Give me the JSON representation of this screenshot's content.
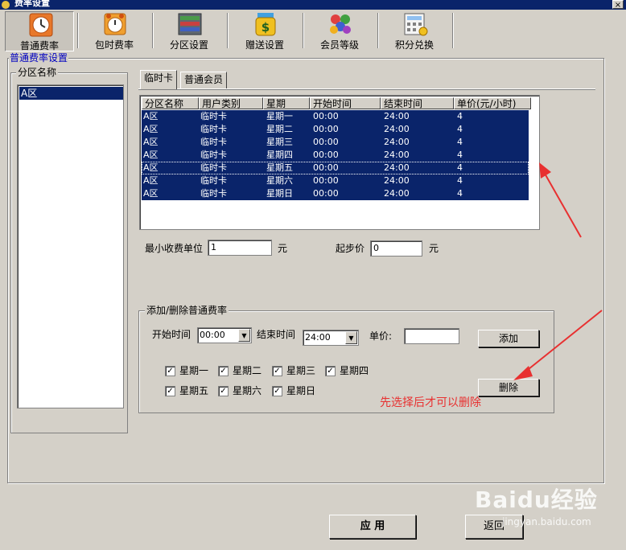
{
  "window": {
    "title": "费率设置",
    "close": "×"
  },
  "toolbar": {
    "buttons": [
      {
        "label": "普通费率"
      },
      {
        "label": "包时费率"
      },
      {
        "label": "分区设置"
      },
      {
        "label": "赠送设置"
      },
      {
        "label": "会员等级"
      },
      {
        "label": "积分兑换"
      }
    ]
  },
  "main": {
    "legend": "普通费率设置"
  },
  "zones": {
    "legend": "分区名称",
    "items": [
      "A区"
    ]
  },
  "tabs": [
    {
      "label": "临时卡"
    },
    {
      "label": "普通会员"
    }
  ],
  "grid": {
    "columns": [
      "分区名称",
      "用户类别",
      "星期",
      "开始时间",
      "结束时间",
      "单价(元/小时)"
    ],
    "rows": [
      [
        "A区",
        "临时卡",
        "星期一",
        "00:00",
        "24:00",
        "4"
      ],
      [
        "A区",
        "临时卡",
        "星期二",
        "00:00",
        "24:00",
        "4"
      ],
      [
        "A区",
        "临时卡",
        "星期三",
        "00:00",
        "24:00",
        "4"
      ],
      [
        "A区",
        "临时卡",
        "星期四",
        "00:00",
        "24:00",
        "4"
      ],
      [
        "A区",
        "临时卡",
        "星期五",
        "00:00",
        "24:00",
        "4"
      ],
      [
        "A区",
        "临时卡",
        "星期六",
        "00:00",
        "24:00",
        "4"
      ],
      [
        "A区",
        "临时卡",
        "星期日",
        "00:00",
        "24:00",
        "4"
      ]
    ]
  },
  "settings": {
    "min_unit_label": "最小收费单位",
    "min_unit_value": "1",
    "unit1": "元",
    "start_price_label": "起步价",
    "start_price_value": "0",
    "unit2": "元"
  },
  "add_section": {
    "legend": "添加/删除普通费率",
    "start_label": "开始时间",
    "start_value": "00:00",
    "end_label": "结束时间",
    "end_value": "24:00",
    "price_label": "单价:",
    "price_value": "",
    "add_button": "添加",
    "delete_button": "删除",
    "days": [
      {
        "label": "星期一",
        "checked": true
      },
      {
        "label": "星期二",
        "checked": true
      },
      {
        "label": "星期三",
        "checked": true
      },
      {
        "label": "星期四",
        "checked": true
      },
      {
        "label": "星期五",
        "checked": true
      },
      {
        "label": "星期六",
        "checked": true
      },
      {
        "label": "星期日",
        "checked": true
      }
    ]
  },
  "annotation": {
    "note": "先选择后才可以删除",
    "color": "#e83030"
  },
  "footer": {
    "apply": "应 用",
    "back": "返回"
  },
  "watermark": {
    "brand": "Baidu经验",
    "url": "jingyan.baidu.com"
  },
  "colors": {
    "selection": "#0a246a",
    "face": "#d4d0c8",
    "legend_blue": "#0000c0"
  }
}
